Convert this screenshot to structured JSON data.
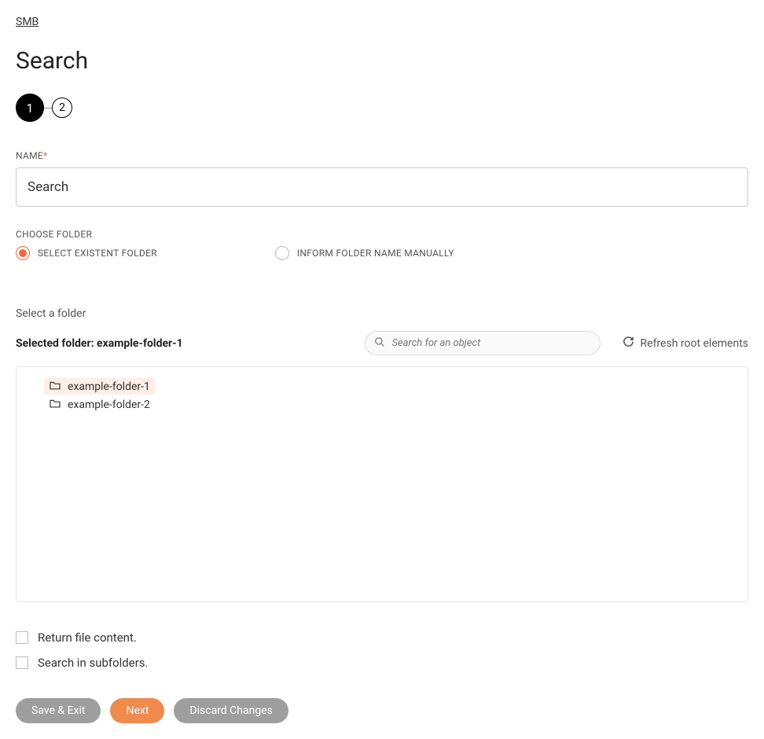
{
  "breadcrumb": "SMB",
  "page_title": "Search",
  "stepper": {
    "steps": [
      "1",
      "2"
    ],
    "active_index": 0
  },
  "name_field": {
    "label": "NAME",
    "required": true,
    "value": "Search"
  },
  "choose_folder": {
    "label": "CHOOSE FOLDER",
    "options": [
      {
        "label": "SELECT EXISTENT FOLDER",
        "selected": true
      },
      {
        "label": "INFORM FOLDER NAME MANUALLY",
        "selected": false
      }
    ]
  },
  "folder_section": {
    "subtitle": "Select a folder",
    "selected_prefix": "Selected folder: ",
    "selected_value": "example-folder-1",
    "search_placeholder": "Search for an object",
    "refresh_label": "Refresh root elements",
    "tree": [
      {
        "name": "example-folder-1",
        "selected": true
      },
      {
        "name": "example-folder-2",
        "selected": false
      }
    ]
  },
  "checkboxes": [
    {
      "label": "Return file content.",
      "checked": false
    },
    {
      "label": "Search in subfolders.",
      "checked": false
    }
  ],
  "buttons": {
    "save_exit": "Save & Exit",
    "next": "Next",
    "discard": "Discard Changes"
  }
}
